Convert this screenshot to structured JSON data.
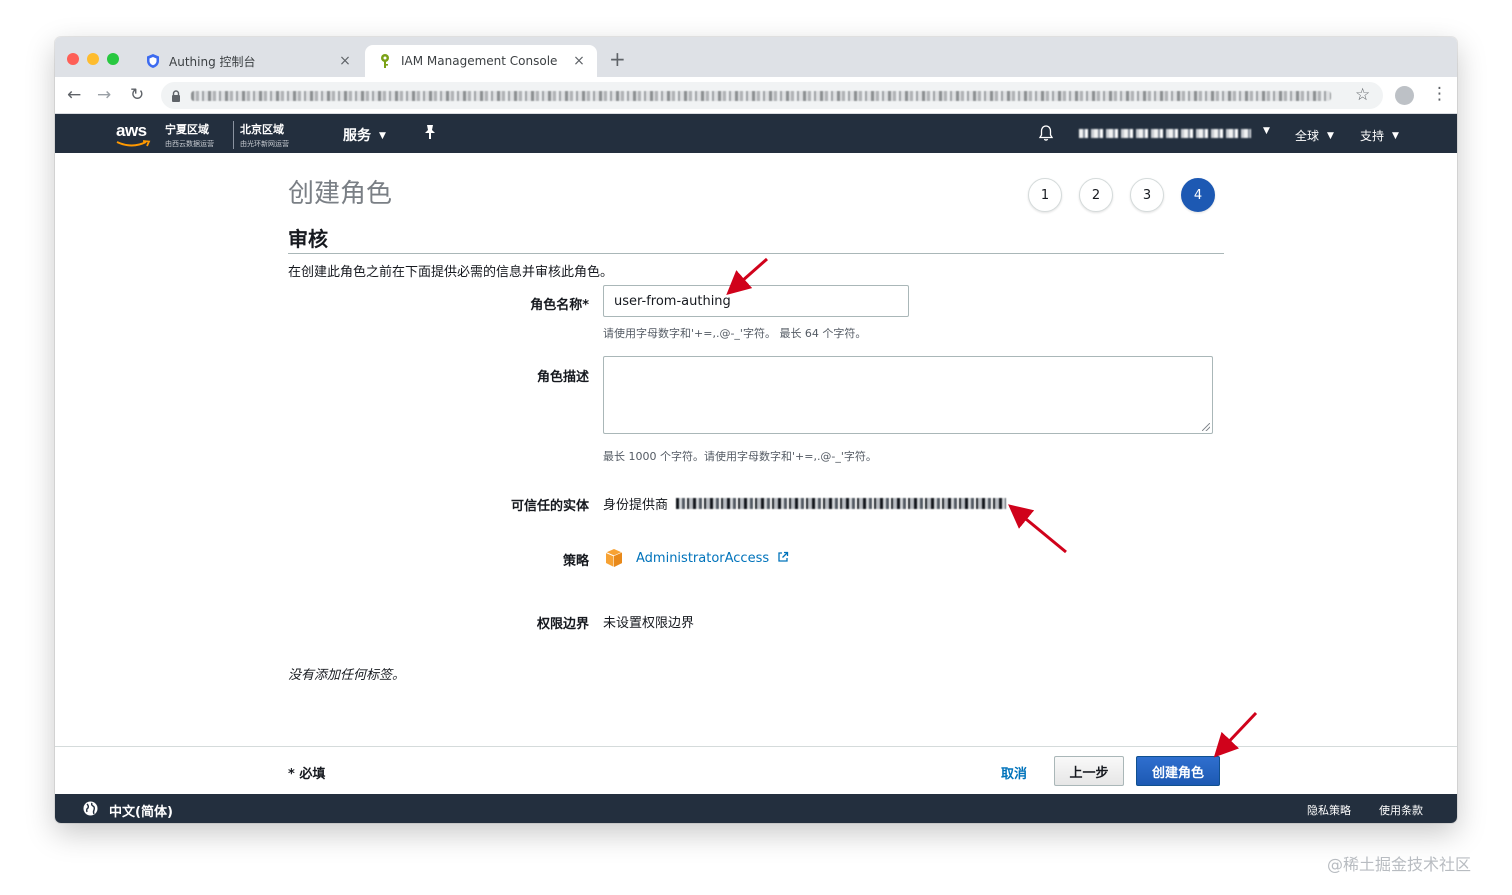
{
  "browser": {
    "tabs": [
      {
        "title": "Authing 控制台",
        "active": false
      },
      {
        "title": "IAM Management Console",
        "active": true
      }
    ],
    "new_tab_label": "+",
    "close_glyph": "×",
    "icons": [
      "back-arrow-icon",
      "forward-arrow-icon",
      "reload-icon",
      "lock-icon",
      "star-icon",
      "profile-icon",
      "more-icon"
    ]
  },
  "aws_header": {
    "logo_text": "aws",
    "region1": {
      "title": "宁夏区域",
      "subtitle": "由西云数据运营"
    },
    "region2": {
      "title": "北京区域",
      "subtitle": "由光环新网运营"
    },
    "services_label": "服务",
    "global_label": "全球",
    "support_label": "支持"
  },
  "page": {
    "title": "创建角色",
    "steps": [
      "1",
      "2",
      "3",
      "4"
    ],
    "current_step": 4,
    "section_title": "审核",
    "intro": "在创建此角色之前在下面提供必需的信息并审核此角色。",
    "fields": {
      "role_name_label": "角色名称*",
      "role_name_value": "user-from-authing",
      "role_name_hint": "请使用字母数字和'+=,.@-_'字符。 最长 64 个字符。",
      "role_desc_label": "角色描述",
      "role_desc_value": "",
      "role_desc_hint": "最长 1000 个字符。请使用字母数字和'+=,.@-_'字符。",
      "trusted_entity_label": "可信任的实体",
      "trusted_entity_value": "身份提供商",
      "policy_label": "策略",
      "policy_value": "AdministratorAccess",
      "boundary_label": "权限边界",
      "boundary_value": "未设置权限边界"
    },
    "no_tags": "没有添加任何标签。"
  },
  "actions": {
    "required_note": "* 必填",
    "cancel": "取消",
    "previous": "上一步",
    "create": "创建角色"
  },
  "footer": {
    "language": "中文(简体)",
    "privacy": "隐私策略",
    "terms": "使用条款"
  },
  "watermark": "@稀土掘金技术社区",
  "colors": {
    "aws_nav": "#232f3e",
    "primary_button": "#1d59b3",
    "link": "#0073bb",
    "annotation_arrow": "#d0021b",
    "policy_icon": "#f7a233"
  }
}
